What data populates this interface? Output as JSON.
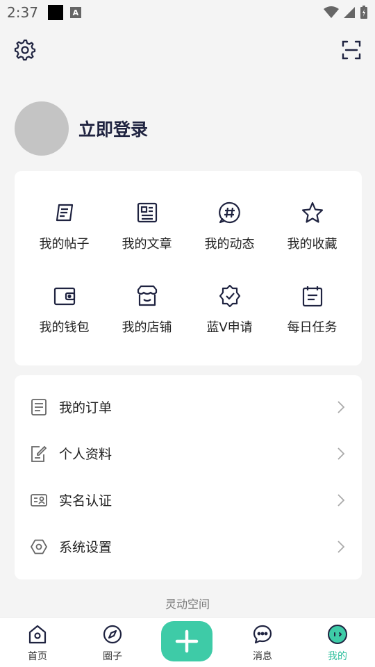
{
  "status_bar": {
    "time": "2:37",
    "a_badge": "A"
  },
  "profile": {
    "login_label": "立即登录"
  },
  "grid": [
    {
      "label": "我的帖子"
    },
    {
      "label": "我的文章"
    },
    {
      "label": "我的动态"
    },
    {
      "label": "我的收藏"
    },
    {
      "label": "我的钱包"
    },
    {
      "label": "我的店铺"
    },
    {
      "label": "蓝V申请"
    },
    {
      "label": "每日任务"
    }
  ],
  "menu": [
    {
      "label": "我的订单"
    },
    {
      "label": "个人资料"
    },
    {
      "label": "实名认证"
    },
    {
      "label": "系统设置"
    }
  ],
  "footer": {
    "brand": "灵动空间"
  },
  "tabbar": [
    {
      "label": "首页"
    },
    {
      "label": "圈子"
    },
    {
      "label": "消息"
    },
    {
      "label": "我的"
    }
  ],
  "colors": {
    "accent": "#3ecba7",
    "active_tab": "#2fbf9d",
    "icon": "#1f2340"
  }
}
